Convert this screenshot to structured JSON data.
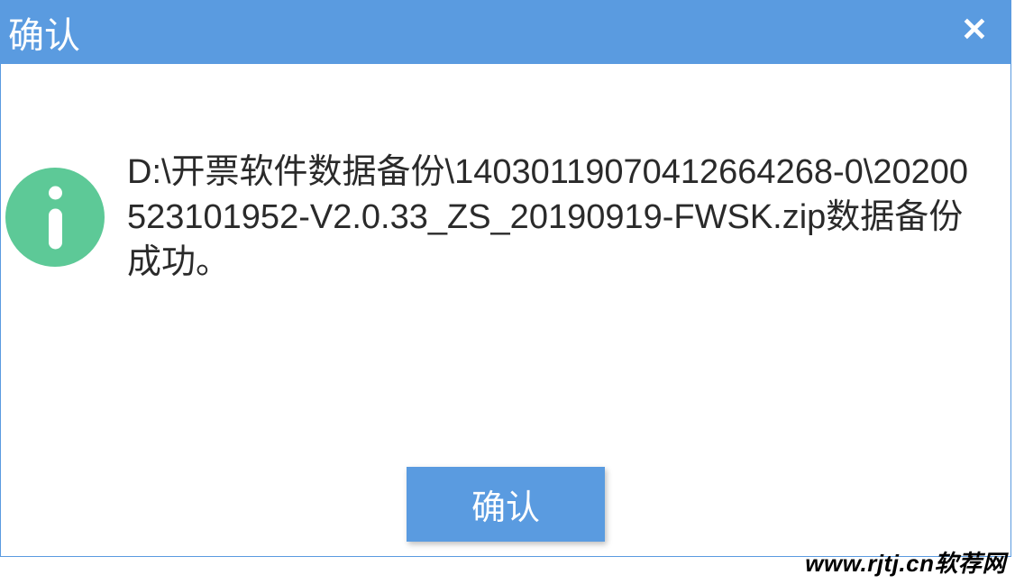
{
  "dialog": {
    "title": "确认",
    "close_label": "✕",
    "message": "D:\\开票软件数据备份\\140301190704126642​68-0\\20200523101952-V2.0.33_ZS_20190919-FWSK.zip数据备份成功。",
    "confirm_button": "确认"
  },
  "watermark": "www.rjtj.cn软荐网",
  "colors": {
    "primary": "#5a9be0",
    "success_icon": "#5dc997"
  }
}
